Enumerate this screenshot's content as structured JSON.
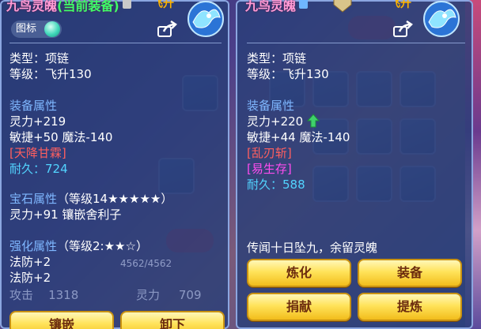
{
  "left_panel": {
    "item_name": "九鸟灵魄",
    "item_tag": "(当前装备)",
    "power_label": "飞升",
    "icon_toggle_label": "图标",
    "type_line": "类型：项链",
    "level_line": "等级：飞升130",
    "equip_attr_title": "装备属性",
    "stat1": "灵力+219",
    "stat2": "敏捷+50 魔法-140",
    "special": "[天降甘霖]",
    "durability_label": "耐久：",
    "durability_value": "724",
    "gem_title": "宝石属性",
    "gem_level": "（等级14★★★★★）",
    "gem_stat": "灵力+91 镶嵌舍利子",
    "enhance_title": "强化属性",
    "enhance_level": "（等级2:★★☆）",
    "enhance_stat1": "法防+2",
    "enhance_stat2": "法防+2",
    "button_embed": "镶嵌",
    "button_unequip": "卸下"
  },
  "right_panel": {
    "item_name": "九鸟灵魄",
    "power_label": "飞升",
    "type_line": "类型：项链",
    "level_line": "等级：飞升130",
    "equip_attr_title": "装备属性",
    "stat1": "灵力+220",
    "stat2": "敏捷+44 魔法-140",
    "special1": "[乱刃斩]",
    "special2": "[易生存]",
    "durability_label": "耐久：",
    "durability_value": "588",
    "lore": "传闻十日坠九，余留灵魄",
    "button_refine": "炼化",
    "button_equip": "装备",
    "button_donate": "捐献",
    "button_extract": "提炼"
  },
  "background": {
    "bar_text": "4562/4562",
    "attack_label": "攻击",
    "attack_value": "1318",
    "spirit_label": "灵力",
    "spirit_value": "709"
  },
  "colors": {
    "name_pink": "#ff9bd6",
    "current_green": "#3dff6a",
    "attr_blue": "#7fb7ff",
    "special_red": "#ff5f5f",
    "special_magenta": "#ff4cf0",
    "durability_cyan": "#52d4ff",
    "button_gold": "#ffe35a",
    "up_arrow_green": "#3fd16b"
  },
  "icons": {
    "share": "share-icon",
    "crest": "phoenix-crest-icon",
    "up_arrow": "up-arrow-icon",
    "toggle": "toggle-knob-icon"
  }
}
